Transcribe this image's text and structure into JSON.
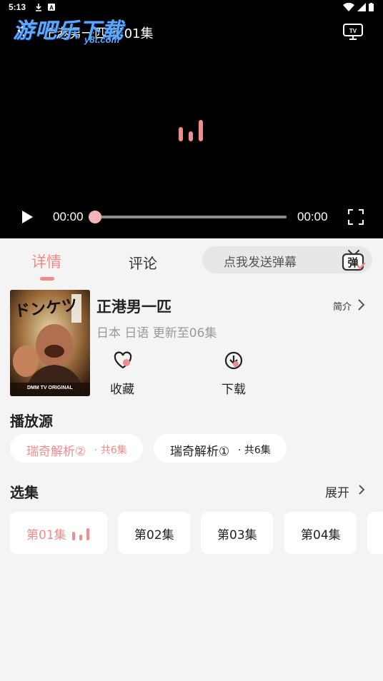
{
  "status_bar": {
    "time": "5:13"
  },
  "watermark": {
    "text": "游吧乐下载",
    "sub": "y8t.com"
  },
  "player": {
    "title": "正港男一匹 第01集",
    "current_time": "00:00",
    "total_time": "00:00",
    "progress": 0,
    "accent": "#f08c8c"
  },
  "tabs": [
    {
      "label": "详情",
      "active": true
    },
    {
      "label": "评论",
      "active": false
    }
  ],
  "danmu": {
    "placeholder": "点我发送弹幕",
    "icon_text": "弹"
  },
  "show": {
    "title": "正港男一匹",
    "intro_label": "简介",
    "meta": "日本 日语 更新至06集",
    "poster_text": "ドンケツ",
    "poster_sub": "DMM TV ORIGINAL",
    "actions": [
      {
        "label": "收藏",
        "icon": "heart-icon"
      },
      {
        "label": "下载",
        "icon": "download-icon"
      }
    ]
  },
  "sources": {
    "title": "播放源",
    "items": [
      {
        "name": "瑞奇解析②",
        "count": "· 共6集",
        "active": true
      },
      {
        "name": "瑞奇解析①",
        "count": "· 共6集",
        "active": false
      }
    ]
  },
  "episodes": {
    "title": "选集",
    "expand_label": "展开",
    "items": [
      {
        "label": "第01集",
        "active": true
      },
      {
        "label": "第02集",
        "active": false
      },
      {
        "label": "第03集",
        "active": false
      },
      {
        "label": "第04集",
        "active": false
      }
    ]
  }
}
